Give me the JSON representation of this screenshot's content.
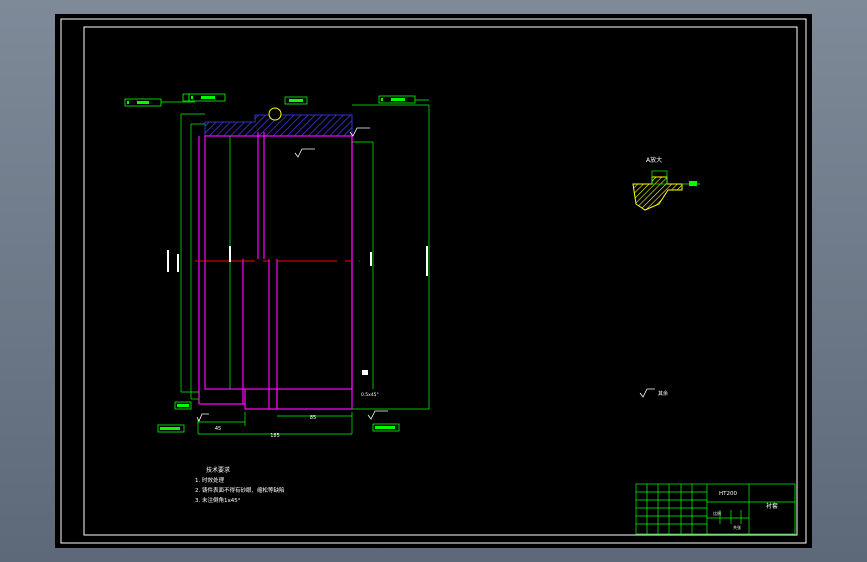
{
  "colors": {
    "background": "#000000",
    "frame": "#ffffff",
    "dimension": "#00ff00",
    "outline": "#ff00ff",
    "centerline": "#ff0000",
    "hatch": "#4040ff",
    "detail": "#ffff00"
  },
  "main_view": {
    "dims_horizontal": [
      "45",
      "85",
      "185"
    ],
    "dim_chamfer": "0.5x45°",
    "roughness": "Ra3.2"
  },
  "detail_view": {
    "label": "A放大"
  },
  "technical_notes": {
    "title": "技术要求",
    "items": [
      "1. 时效处理",
      "2. 铸件表面不得有砂眼、缩松等缺陷",
      "3. 未注倒角1x45°"
    ]
  },
  "roughness_note": "其余",
  "title_block": {
    "material": "HT200",
    "part_name": "衬套",
    "scale_label": "比例",
    "sheet_label": "共张"
  }
}
